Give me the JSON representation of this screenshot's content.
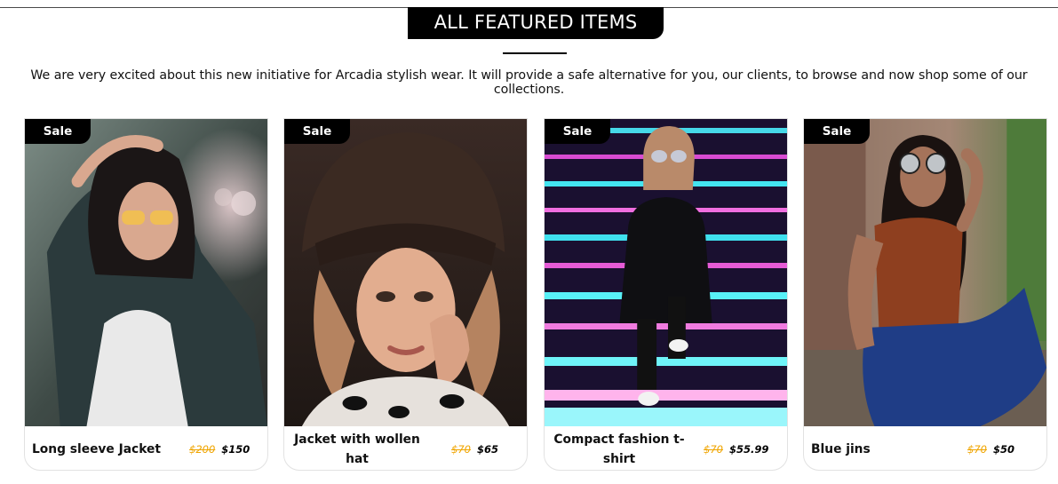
{
  "header": {
    "title": "ALL FEATURED ITEMS",
    "intro": "We are very excited about this new initiative for Arcadia stylish wear. It will provide a safe alternative for you, our clients, to browse and now shop some of our collections."
  },
  "colors": {
    "badge_bg": "#000000",
    "old_price": "#f0a500",
    "new_price": "#000000"
  },
  "products": [
    {
      "badge": "Sale",
      "name": "Long sleeve Jacket",
      "old_price": "$200",
      "new_price": "$150"
    },
    {
      "badge": "Sale",
      "name": "Jacket with wollen hat",
      "old_price": "$70",
      "new_price": "$65"
    },
    {
      "badge": "Sale",
      "name": "Compact fashion t-shirt",
      "old_price": "$70",
      "new_price": "$55.99"
    },
    {
      "badge": "Sale",
      "name": "Blue jins",
      "old_price": "$70",
      "new_price": "$50"
    }
  ]
}
